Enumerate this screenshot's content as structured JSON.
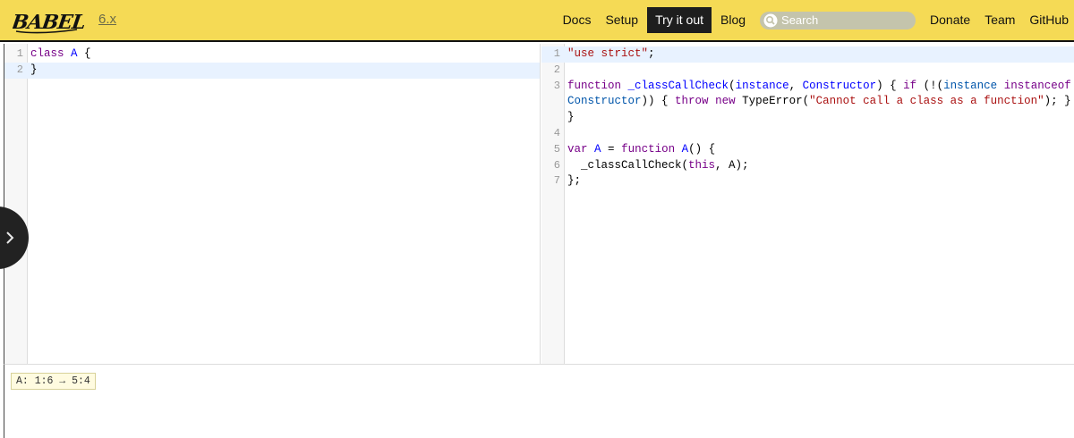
{
  "header": {
    "logo_text": "BABEL",
    "version": "6.x",
    "nav": [
      {
        "label": "Docs",
        "active": false
      },
      {
        "label": "Setup",
        "active": false
      },
      {
        "label": "Try it out",
        "active": true
      },
      {
        "label": "Blog",
        "active": false
      }
    ],
    "search": {
      "placeholder": "Search",
      "icon": "search-icon"
    },
    "nav_right": [
      {
        "label": "Donate"
      },
      {
        "label": "Team"
      },
      {
        "label": "GitHub"
      }
    ],
    "brand_color": "#f5da55"
  },
  "input_editor": {
    "lines": [
      {
        "n": "1",
        "tokens": [
          [
            "kw",
            "class"
          ],
          [
            "plain",
            " "
          ],
          [
            "def",
            "A"
          ],
          [
            "plain",
            " {"
          ]
        ]
      },
      {
        "n": "2",
        "tokens": [
          [
            "plain",
            "}"
          ]
        ],
        "active": true
      }
    ]
  },
  "output_editor": {
    "lines": [
      {
        "n": "1",
        "tokens": [
          [
            "str",
            "\"use strict\""
          ],
          [
            "plain",
            ";"
          ]
        ],
        "active": true
      },
      {
        "n": "2",
        "tokens": []
      },
      {
        "n": "3",
        "tokens": [
          [
            "kw",
            "function"
          ],
          [
            "plain",
            " "
          ],
          [
            "def",
            "_classCallCheck"
          ],
          [
            "plain",
            "("
          ],
          [
            "def",
            "instance"
          ],
          [
            "plain",
            ", "
          ],
          [
            "def",
            "Constructor"
          ],
          [
            "plain",
            ") { "
          ],
          [
            "kw",
            "if"
          ],
          [
            "plain",
            " (!("
          ],
          [
            "var2",
            "instance"
          ],
          [
            "plain",
            " "
          ],
          [
            "kw",
            "instanceof"
          ]
        ]
      },
      {
        "n": "",
        "tokens": [
          [
            "var2",
            "Constructor"
          ],
          [
            "plain",
            ")) { "
          ],
          [
            "kw",
            "throw"
          ],
          [
            "plain",
            " "
          ],
          [
            "kw",
            "new"
          ],
          [
            "plain",
            " TypeError("
          ],
          [
            "str",
            "\"Cannot call a class as a function\""
          ],
          [
            "plain",
            "); }"
          ]
        ]
      },
      {
        "n": "",
        "tokens": [
          [
            "plain",
            "}"
          ]
        ]
      },
      {
        "n": "4",
        "tokens": []
      },
      {
        "n": "5",
        "tokens": [
          [
            "kw",
            "var"
          ],
          [
            "plain",
            " "
          ],
          [
            "def",
            "A"
          ],
          [
            "plain",
            " = "
          ],
          [
            "kw",
            "function"
          ],
          [
            "plain",
            " "
          ],
          [
            "def",
            "A"
          ],
          [
            "plain",
            "() {"
          ]
        ]
      },
      {
        "n": "6",
        "tokens": [
          [
            "plain",
            "  _classCallCheck("
          ],
          [
            "kw",
            "this"
          ],
          [
            "plain",
            ", A);"
          ]
        ]
      },
      {
        "n": "7",
        "tokens": [
          [
            "plain",
            "};"
          ]
        ]
      }
    ]
  },
  "sidebar_toggle": {
    "icon": "chevron-right-icon"
  },
  "bottom_panel": {
    "mapping_label": "A: 1:6 → 5:4"
  }
}
